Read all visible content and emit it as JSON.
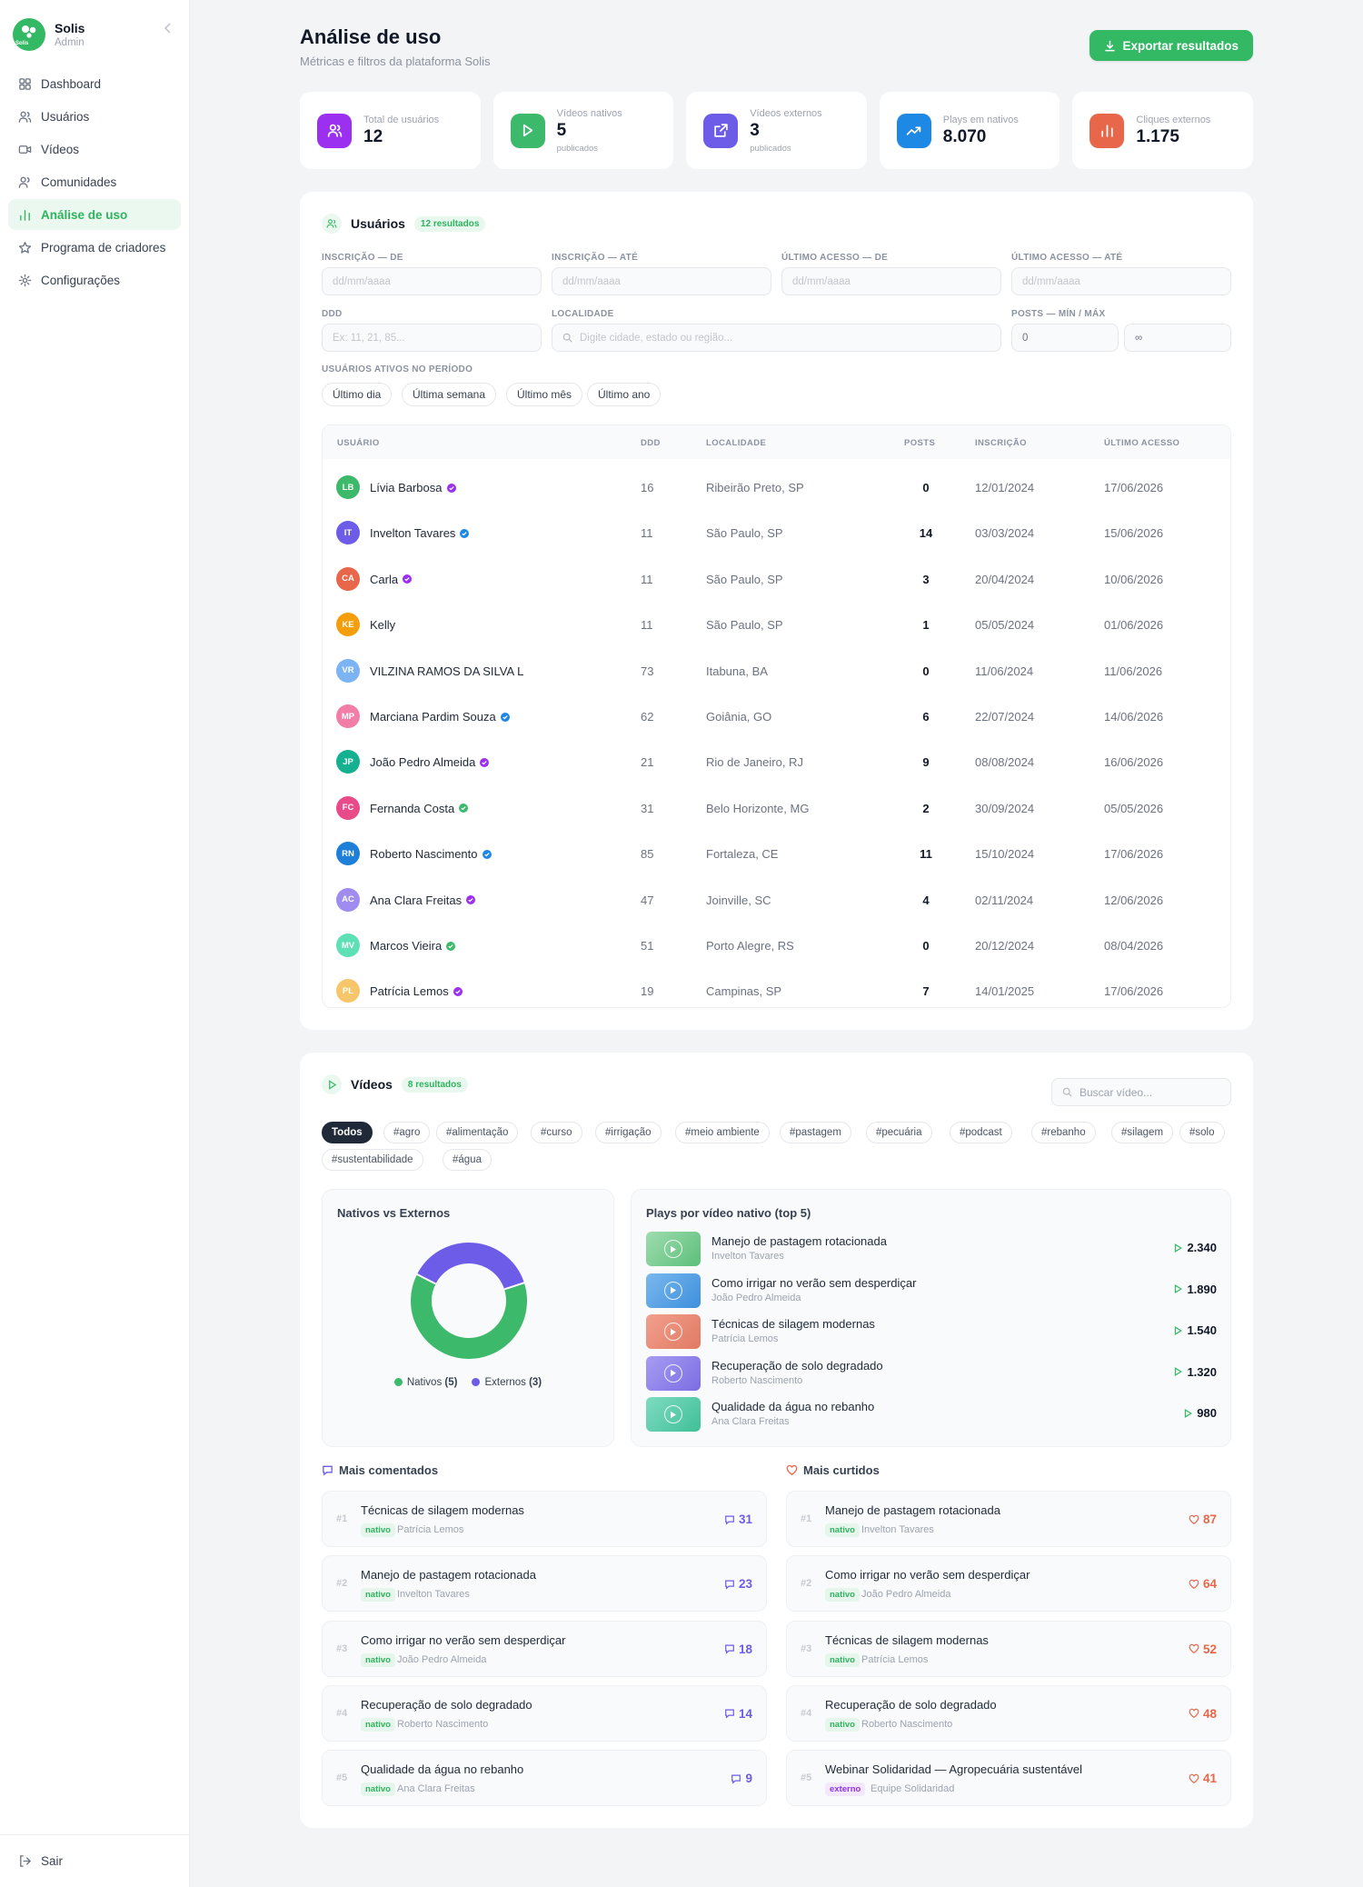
{
  "sidebar": {
    "brand_name": "Solis",
    "brand_logo_text": "Solis",
    "role": "Admin",
    "items": [
      {
        "label": "Dashboard",
        "icon": "grid-icon",
        "active": false
      },
      {
        "label": "Usuários",
        "icon": "users-icon",
        "active": false
      },
      {
        "label": "Vídeos",
        "icon": "video-icon",
        "active": false
      },
      {
        "label": "Comunidades",
        "icon": "community-icon",
        "active": false
      },
      {
        "label": "Análise de uso",
        "icon": "bar-chart-icon",
        "active": true
      },
      {
        "label": "Programa de criadores",
        "icon": "star-icon",
        "active": false
      },
      {
        "label": "Configurações",
        "icon": "gear-icon",
        "active": false
      }
    ],
    "logout": "Sair"
  },
  "header": {
    "title": "Análise de uso",
    "subtitle": "Métricas e filtros da plataforma Solis",
    "export_label": "Exportar resultados"
  },
  "stats": [
    {
      "label": "Total de usuários",
      "value": "12",
      "sub": "",
      "icon": "users-icon",
      "color": "#9b30f0"
    },
    {
      "label": "Vídeos nativos",
      "value": "5",
      "sub": "publicados",
      "icon": "play-icon",
      "color": "#3cb96a"
    },
    {
      "label": "Vídeos externos",
      "value": "3",
      "sub": "publicados",
      "icon": "external-link-icon",
      "color": "#6c5ce7"
    },
    {
      "label": "Plays em nativos",
      "value": "8.070",
      "sub": "",
      "icon": "trending-up-icon",
      "color": "#1e88e5"
    },
    {
      "label": "Cliques externos",
      "value": "1.175",
      "sub": "",
      "icon": "bar-chart-icon",
      "color": "#e8674a"
    }
  ],
  "users": {
    "title": "Usuários",
    "count": "12 resultados",
    "filters": {
      "insc_de_label": "INSCRIÇÃO — DE",
      "insc_ate_label": "INSCRIÇÃO — ATÉ",
      "acesso_de_label": "ÚLTIMO ACESSO — DE",
      "acesso_ate_label": "ÚLTIMO ACESSO — ATÉ",
      "date_placeholder": "dd/mm/aaaa",
      "ddd_label": "DDD",
      "ddd_placeholder": "Ex: 11, 21, 85...",
      "local_label": "LOCALIDADE",
      "local_placeholder": "Digite cidade, estado ou região...",
      "posts_label": "POSTS — MÍN / MÁX",
      "posts_min": "0",
      "posts_max": "∞",
      "active_label": "USUÁRIOS ATIVOS NO PERÍODO",
      "periods": [
        "Último dia",
        "Última semana",
        "Último mês",
        "Último ano"
      ]
    },
    "columns": [
      "USUÁRIO",
      "DDD",
      "LOCALIDADE",
      "POSTS",
      "INSCRIÇÃO",
      "ÚLTIMO ACESSO"
    ],
    "rows": [
      {
        "initials": "LB",
        "name": "Lívia Barbosa",
        "verified": "#9b30f0",
        "color": "#3cb96a",
        "ddd": "16",
        "local": "Ribeirão Preto, SP",
        "posts": "0",
        "insc": "12/01/2024",
        "acesso": "17/06/2026"
      },
      {
        "initials": "IT",
        "name": "Invelton Tavares",
        "verified": "#1e88e5",
        "color": "#6c5ce7",
        "ddd": "11",
        "local": "São Paulo, SP",
        "posts": "14",
        "insc": "03/03/2024",
        "acesso": "15/06/2026"
      },
      {
        "initials": "CA",
        "name": "Carla",
        "verified": "#9b30f0",
        "color": "#e8674a",
        "ddd": "11",
        "local": "São Paulo, SP",
        "posts": "3",
        "insc": "20/04/2024",
        "acesso": "10/06/2026"
      },
      {
        "initials": "KE",
        "name": "Kelly",
        "verified": "",
        "color": "#f59e0b",
        "ddd": "11",
        "local": "São Paulo, SP",
        "posts": "1",
        "insc": "05/05/2024",
        "acesso": "01/06/2026"
      },
      {
        "initials": "VR",
        "name": "VILZINA RAMOS DA SILVA L",
        "verified": "",
        "color": "#7cb3f2",
        "ddd": "73",
        "local": "Itabuna, BA",
        "posts": "0",
        "insc": "11/06/2024",
        "acesso": "11/06/2026"
      },
      {
        "initials": "MP",
        "name": "Marciana Pardim Souza",
        "verified": "#1e88e5",
        "color": "#f27ea8",
        "ddd": "62",
        "local": "Goiânia, GO",
        "posts": "6",
        "insc": "22/07/2024",
        "acesso": "14/06/2026"
      },
      {
        "initials": "JP",
        "name": "João Pedro Almeida",
        "verified": "#9b30f0",
        "color": "#14b090",
        "ddd": "21",
        "local": "Rio de Janeiro, RJ",
        "posts": "9",
        "insc": "08/08/2024",
        "acesso": "16/06/2026"
      },
      {
        "initials": "FC",
        "name": "Fernanda Costa",
        "verified": "#3cb96a",
        "color": "#e84a8a",
        "ddd": "31",
        "local": "Belo Horizonte, MG",
        "posts": "2",
        "insc": "30/09/2024",
        "acesso": "05/05/2026"
      },
      {
        "initials": "RN",
        "name": "Roberto Nascimento",
        "verified": "#1e88e5",
        "color": "#1e7fd8",
        "ddd": "85",
        "local": "Fortaleza, CE",
        "posts": "11",
        "insc": "15/10/2024",
        "acesso": "17/06/2026"
      },
      {
        "initials": "AC",
        "name": "Ana Clara Freitas",
        "verified": "#9b30f0",
        "color": "#a08cf0",
        "ddd": "47",
        "local": "Joinville, SC",
        "posts": "4",
        "insc": "02/11/2024",
        "acesso": "12/06/2026"
      },
      {
        "initials": "MV",
        "name": "Marcos Vieira",
        "verified": "#3cb96a",
        "color": "#5ee0b5",
        "ddd": "51",
        "local": "Porto Alegre, RS",
        "posts": "0",
        "insc": "20/12/2024",
        "acesso": "08/04/2026"
      },
      {
        "initials": "PL",
        "name": "Patrícia Lemos",
        "verified": "#9b30f0",
        "color": "#f7c66b",
        "ddd": "19",
        "local": "Campinas, SP",
        "posts": "7",
        "insc": "14/01/2025",
        "acesso": "17/06/2026"
      }
    ]
  },
  "videos": {
    "title": "Vídeos",
    "count": "8 resultados",
    "search_placeholder": "Buscar vídeo...",
    "tags": [
      "Todos",
      "#agro",
      "#alimentação",
      "#curso",
      "#irrigação",
      "#meio ambiente",
      "#pastagem",
      "#pecuária",
      "#podcast",
      "#rebanho",
      "#silagem",
      "#solo",
      "#sustentabilidade",
      "#água"
    ],
    "active_tag": "Todos",
    "donut_title": "Nativos vs Externos",
    "top_title": "Plays por vídeo nativo (top 5)",
    "top": [
      {
        "title": "Manejo de pastagem rotacionada",
        "author": "Invelton Tavares",
        "plays": "2.340",
        "c1": "#9fdcaf",
        "c2": "#5cbf7a"
      },
      {
        "title": "Como irrigar no verão sem desperdiçar",
        "author": "João Pedro Almeida",
        "plays": "1.890",
        "c1": "#7ab8ee",
        "c2": "#3e8fdc"
      },
      {
        "title": "Técnicas de silagem modernas",
        "author": "Patrícia Lemos",
        "plays": "1.540",
        "c1": "#f2a08e",
        "c2": "#e07a63"
      },
      {
        "title": "Recuperação de solo degradado",
        "author": "Roberto Nascimento",
        "plays": "1.320",
        "c1": "#a79cf2",
        "c2": "#7b6de3"
      },
      {
        "title": "Qualidade da água no rebanho",
        "author": "Ana Clara Freitas",
        "plays": "980",
        "c1": "#7fdcc0",
        "c2": "#3fbf97"
      }
    ],
    "most_commented_title": "Mais comentados",
    "most_liked_title": "Mais curtidos",
    "most_commented": [
      {
        "rank": "#1",
        "title": "Técnicas de silagem modernas",
        "type": "nativo",
        "author": "Patrícia Lemos",
        "count": "31"
      },
      {
        "rank": "#2",
        "title": "Manejo de pastagem rotacionada",
        "type": "nativo",
        "author": "Invelton Tavares",
        "count": "23"
      },
      {
        "rank": "#3",
        "title": "Como irrigar no verão sem desperdiçar",
        "type": "nativo",
        "author": "João Pedro Almeida",
        "count": "18"
      },
      {
        "rank": "#4",
        "title": "Recuperação de solo degradado",
        "type": "nativo",
        "author": "Roberto Nascimento",
        "count": "14"
      },
      {
        "rank": "#5",
        "title": "Qualidade da água no rebanho",
        "type": "nativo",
        "author": "Ana Clara Freitas",
        "count": "9"
      }
    ],
    "most_liked": [
      {
        "rank": "#1",
        "title": "Manejo de pastagem rotacionada",
        "type": "nativo",
        "author": "Invelton Tavares",
        "count": "87"
      },
      {
        "rank": "#2",
        "title": "Como irrigar no verão sem desperdiçar",
        "type": "nativo",
        "author": "João Pedro Almeida",
        "count": "64"
      },
      {
        "rank": "#3",
        "title": "Técnicas de silagem modernas",
        "type": "nativo",
        "author": "Patrícia Lemos",
        "count": "52"
      },
      {
        "rank": "#4",
        "title": "Recuperação de solo degradado",
        "type": "nativo",
        "author": "Roberto Nascimento",
        "count": "48"
      },
      {
        "rank": "#5",
        "title": "Webinar Solidaridad — Agropecuária sustentável",
        "type": "externo",
        "author": "Equipe Solidaridad",
        "count": "41"
      }
    ],
    "comment_color": "#6c5ce7",
    "like_color": "#e8674a"
  },
  "chart_data": {
    "type": "pie",
    "categories": [
      "Nativos",
      "Externos"
    ],
    "values": [
      5,
      3
    ],
    "legend_labels": [
      "Nativos",
      "Externos"
    ],
    "legend_counts": [
      "(5)",
      "(3)"
    ],
    "colors": [
      "#3cb96a",
      "#6c5ce7"
    ],
    "legend": "bottom"
  }
}
